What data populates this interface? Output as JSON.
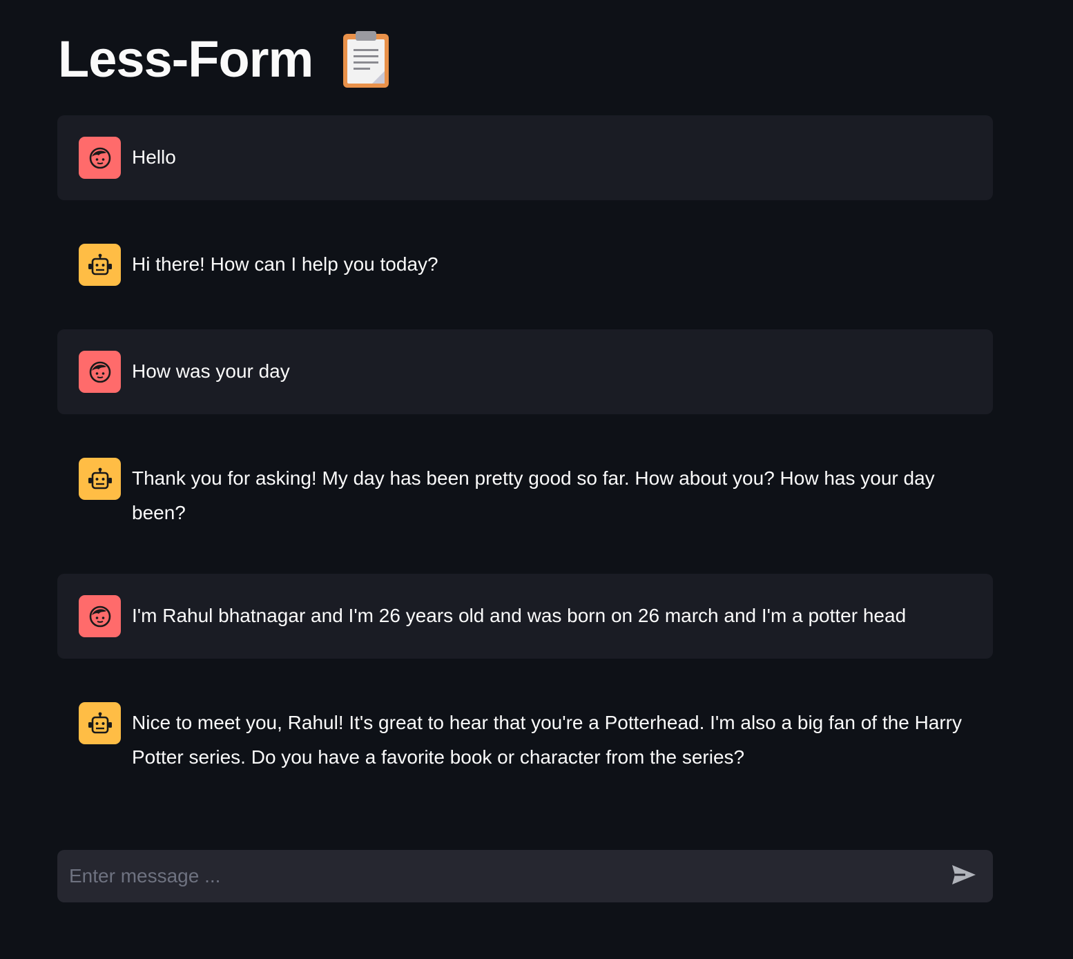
{
  "app": {
    "title": "Less-Form",
    "title_icon": "clipboard-icon"
  },
  "colors": {
    "background": "#0e1117",
    "user_bubble": "#1a1c24",
    "user_avatar": "#ff6b6b",
    "assistant_avatar": "#ffbd45",
    "input_bg": "#262730"
  },
  "messages": [
    {
      "role": "user",
      "avatar_icon": "user-face-icon",
      "text": "Hello"
    },
    {
      "role": "assistant",
      "avatar_icon": "robot-icon",
      "text": "Hi there! How can I help you today?"
    },
    {
      "role": "user",
      "avatar_icon": "user-face-icon",
      "text": "How was your day"
    },
    {
      "role": "assistant",
      "avatar_icon": "robot-icon",
      "text": "Thank you for asking! My day has been pretty good so far. How about you? How has your day been?"
    },
    {
      "role": "user",
      "avatar_icon": "user-face-icon",
      "text": "I'm Rahul bhatnagar and I'm 26 years old and was born on 26 march and I'm a potter head"
    },
    {
      "role": "assistant",
      "avatar_icon": "robot-icon",
      "text": "Nice to meet you, Rahul! It's great to hear that you're a Potterhead. I'm also a big fan of the Harry Potter series. Do you have a favorite book or character from the series?"
    }
  ],
  "chat_input": {
    "placeholder": "Enter message ...",
    "value": "",
    "send_icon": "send-icon"
  }
}
